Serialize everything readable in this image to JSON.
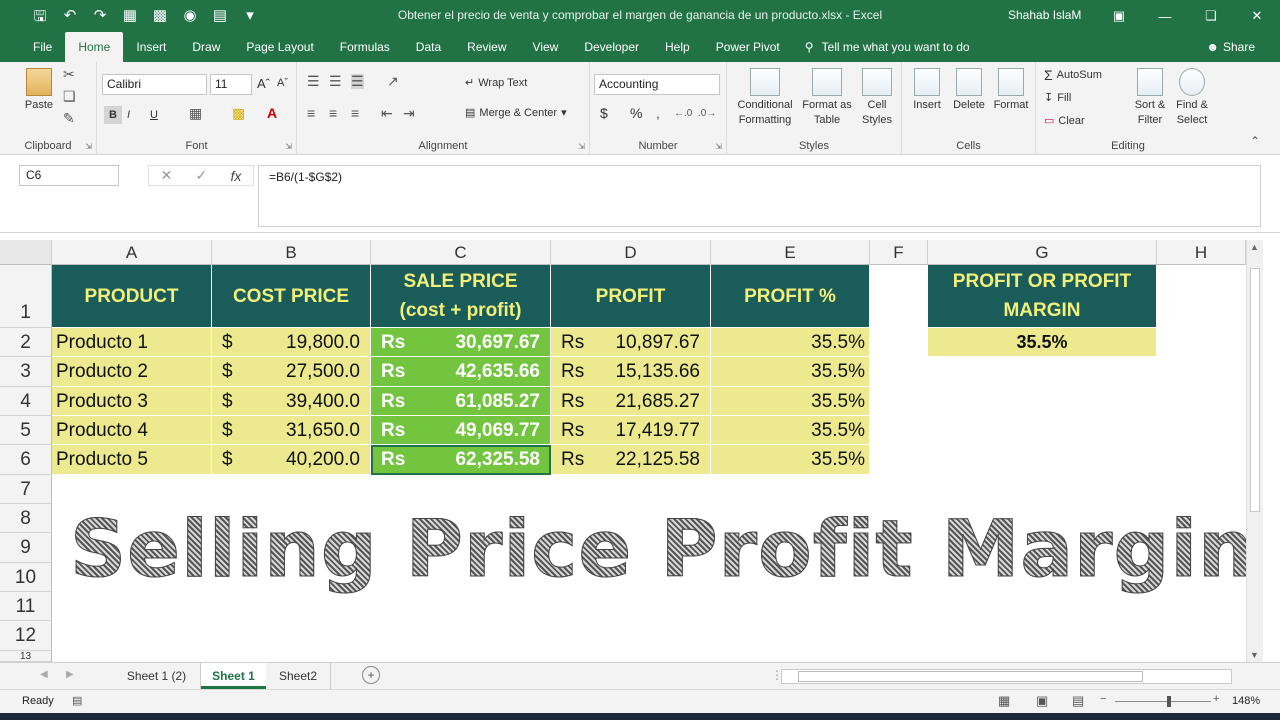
{
  "window": {
    "title": "Obtener el precio de venta y comprobar el margen de ganancia de un producto.xlsx  -  Excel",
    "user": "Shahab IslaM"
  },
  "tabs": [
    "File",
    "Home",
    "Insert",
    "Draw",
    "Page Layout",
    "Formulas",
    "Data",
    "Review",
    "View",
    "Developer",
    "Help",
    "Power Pivot"
  ],
  "active_tab": "Home",
  "tell_me": "Tell me what you want to do",
  "share_label": "Share",
  "ribbon": {
    "clipboard": {
      "paste": "Paste",
      "label": "Clipboard"
    },
    "font": {
      "name": "Calibri",
      "size": "11",
      "label": "Font",
      "bold": "B",
      "italic": "I",
      "underline": "U"
    },
    "alignment": {
      "wrap": "Wrap Text",
      "merge": "Merge & Center",
      "label": "Alignment"
    },
    "number": {
      "format": "Accounting",
      "currency": "$",
      "percent": "%",
      "label": "Number"
    },
    "styles": {
      "conditional": "Conditional Formatting",
      "format_table": "Format as Table",
      "cell_styles": "Cell Styles",
      "label": "Styles"
    },
    "cells": {
      "insert": "Insert",
      "delete": "Delete",
      "format": "Format",
      "label": "Cells"
    },
    "editing": {
      "autosum": "AutoSum",
      "fill": "Fill",
      "clear": "Clear",
      "sort": "Sort & Filter",
      "find": "Find & Select",
      "label": "Editing"
    }
  },
  "formula_bar": {
    "name_box": "C6",
    "formula": "=B6/(1-$G$2)"
  },
  "columns": [
    "A",
    "B",
    "C",
    "D",
    "E",
    "F",
    "G",
    "H"
  ],
  "rows": [
    "1",
    "2",
    "3",
    "4",
    "5",
    "6",
    "7",
    "8",
    "9",
    "10",
    "11",
    "12",
    "13"
  ],
  "table": {
    "headers": [
      "PRODUCT",
      "COST PRICE",
      "SALE PRICE\n(cost + profit)",
      "PROFIT",
      "PROFIT %"
    ],
    "rows": [
      {
        "product": "Producto 1",
        "cost_sym": "$",
        "cost": "19,800.0",
        "sale_sym": "Rs",
        "sale": "30,697.67",
        "profit_sym": "Rs",
        "profit": "10,897.67",
        "pct": "35.5%"
      },
      {
        "product": "Producto 2",
        "cost_sym": "$",
        "cost": "27,500.0",
        "sale_sym": "Rs",
        "sale": "42,635.66",
        "profit_sym": "Rs",
        "profit": "15,135.66",
        "pct": "35.5%"
      },
      {
        "product": "Producto 3",
        "cost_sym": "$",
        "cost": "39,400.0",
        "sale_sym": "Rs",
        "sale": "61,085.27",
        "profit_sym": "Rs",
        "profit": "21,685.27",
        "pct": "35.5%"
      },
      {
        "product": "Producto 4",
        "cost_sym": "$",
        "cost": "31,650.0",
        "sale_sym": "Rs",
        "sale": "49,069.77",
        "profit_sym": "Rs",
        "profit": "17,419.77",
        "pct": "35.5%"
      },
      {
        "product": "Producto 5",
        "cost_sym": "$",
        "cost": "40,200.0",
        "sale_sym": "Rs",
        "sale": "62,325.58",
        "profit_sym": "Rs",
        "profit": "22,125.58",
        "pct": "35.5%"
      }
    ]
  },
  "margin_box": {
    "header": "PROFIT OR PROFIT\nMARGIN",
    "value": "35.5%"
  },
  "watermark": "Selling Price Profit Margin",
  "sheets": [
    "Sheet 1 (2)",
    "Sheet 1",
    "Sheet2"
  ],
  "active_sheet": "Sheet 1",
  "status": {
    "ready": "Ready",
    "zoom": "148%"
  },
  "colors": {
    "header_bg": "#1a5c5a",
    "header_text": "#f2ef7a",
    "yellow": "#ece98f",
    "green": "#73c43f",
    "excel_green": "#217346"
  }
}
